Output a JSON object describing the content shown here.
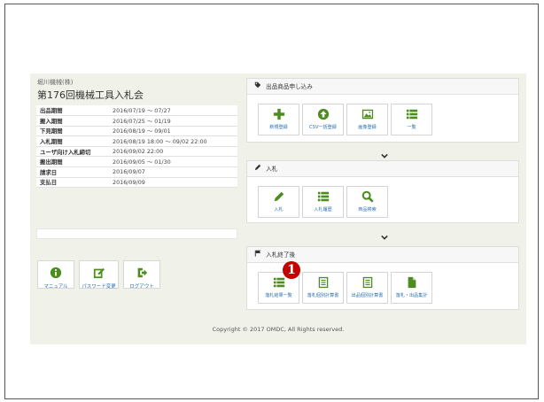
{
  "company_name": "堀川機械(株)",
  "auction_title": "第176回機械工具入札会",
  "schedule": [
    {
      "label": "出品期間",
      "value": "2016/07/19 ～ 07/27"
    },
    {
      "label": "搬入期間",
      "value": "2016/07/25 ～ 01/19"
    },
    {
      "label": "下見期間",
      "value": "2016/08/19 ～ 09/01"
    },
    {
      "label": "入札期間",
      "value": "2016/08/19 18:00 ～ 09/02 22:00"
    },
    {
      "label": "ユーザ向け入札締切",
      "value": "2016/09/02 22:00"
    },
    {
      "label": "搬出期間",
      "value": "2016/09/05 ～ 01/30"
    },
    {
      "label": "請求日",
      "value": "2016/09/07"
    },
    {
      "label": "支払日",
      "value": "2016/09/09"
    }
  ],
  "account_buttons": [
    {
      "label": "マニュアル",
      "icon": "info-icon"
    },
    {
      "label": "パスワード変更",
      "icon": "edit-icon"
    },
    {
      "label": "ログアウト",
      "icon": "logout-icon"
    }
  ],
  "panels": {
    "listing": {
      "title": "出品商品申し込み",
      "icon": "tag-icon",
      "tiles": [
        {
          "label": "新規登録",
          "icon": "plus-icon"
        },
        {
          "label": "CSV一括登録",
          "icon": "upload-circle-icon"
        },
        {
          "label": "画像登録",
          "icon": "image-icon"
        },
        {
          "label": "一覧",
          "icon": "list-icon"
        }
      ]
    },
    "bidding": {
      "title": "入札",
      "icon": "pencil-icon",
      "tiles": [
        {
          "label": "入札",
          "icon": "pencil-icon"
        },
        {
          "label": "入札履歴",
          "icon": "list-icon"
        },
        {
          "label": "商品検索",
          "icon": "search-icon"
        }
      ]
    },
    "closed": {
      "title": "入札終了後",
      "icon": "flag-icon",
      "tiles": [
        {
          "label": "落札結果一覧",
          "icon": "list-icon"
        },
        {
          "label": "落札個別計算書",
          "icon": "document-icon"
        },
        {
          "label": "出品個別計算書",
          "icon": "document-icon"
        },
        {
          "label": "落札・出品集計",
          "icon": "file-icon"
        }
      ]
    }
  },
  "copyright": "Copyright © 2017 OMDC, All Rights reserved.",
  "callout_number": "1",
  "colors": {
    "accent_green": "#4d8c1f",
    "link_blue": "#2a6fb0",
    "page_bg": "#f0f2ea",
    "callout_red": "#c40000"
  }
}
